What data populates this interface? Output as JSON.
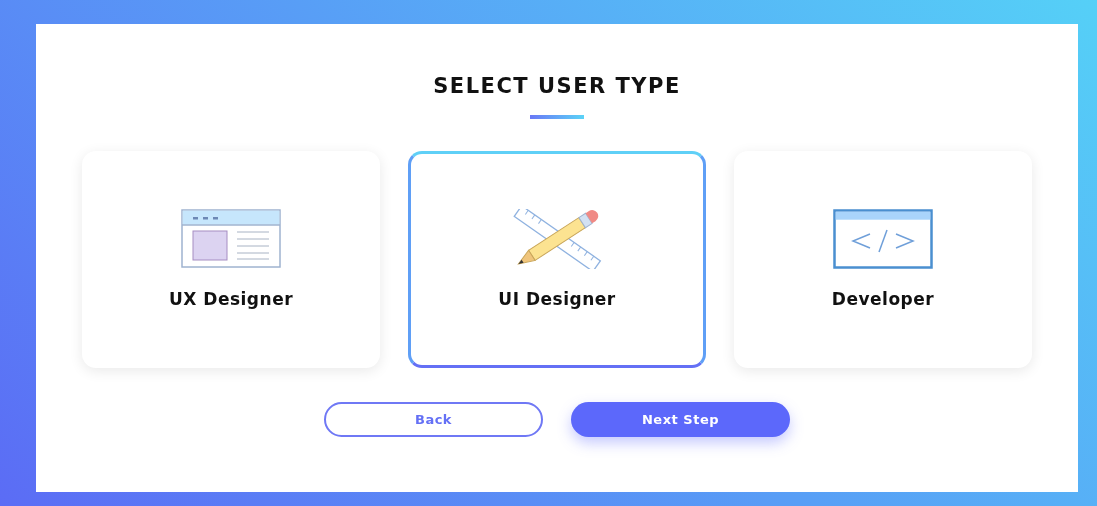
{
  "title": "SELECT USER TYPE",
  "options": [
    {
      "label": "UX Designer",
      "kind": "wireframe",
      "selected": false
    },
    {
      "label": "UI Designer",
      "kind": "tools",
      "selected": true
    },
    {
      "label": "Developer",
      "kind": "code",
      "selected": false
    }
  ],
  "buttons": [
    {
      "label": "Back",
      "kind": "secondary"
    },
    {
      "label": "Next Step",
      "kind": "primary"
    }
  ]
}
